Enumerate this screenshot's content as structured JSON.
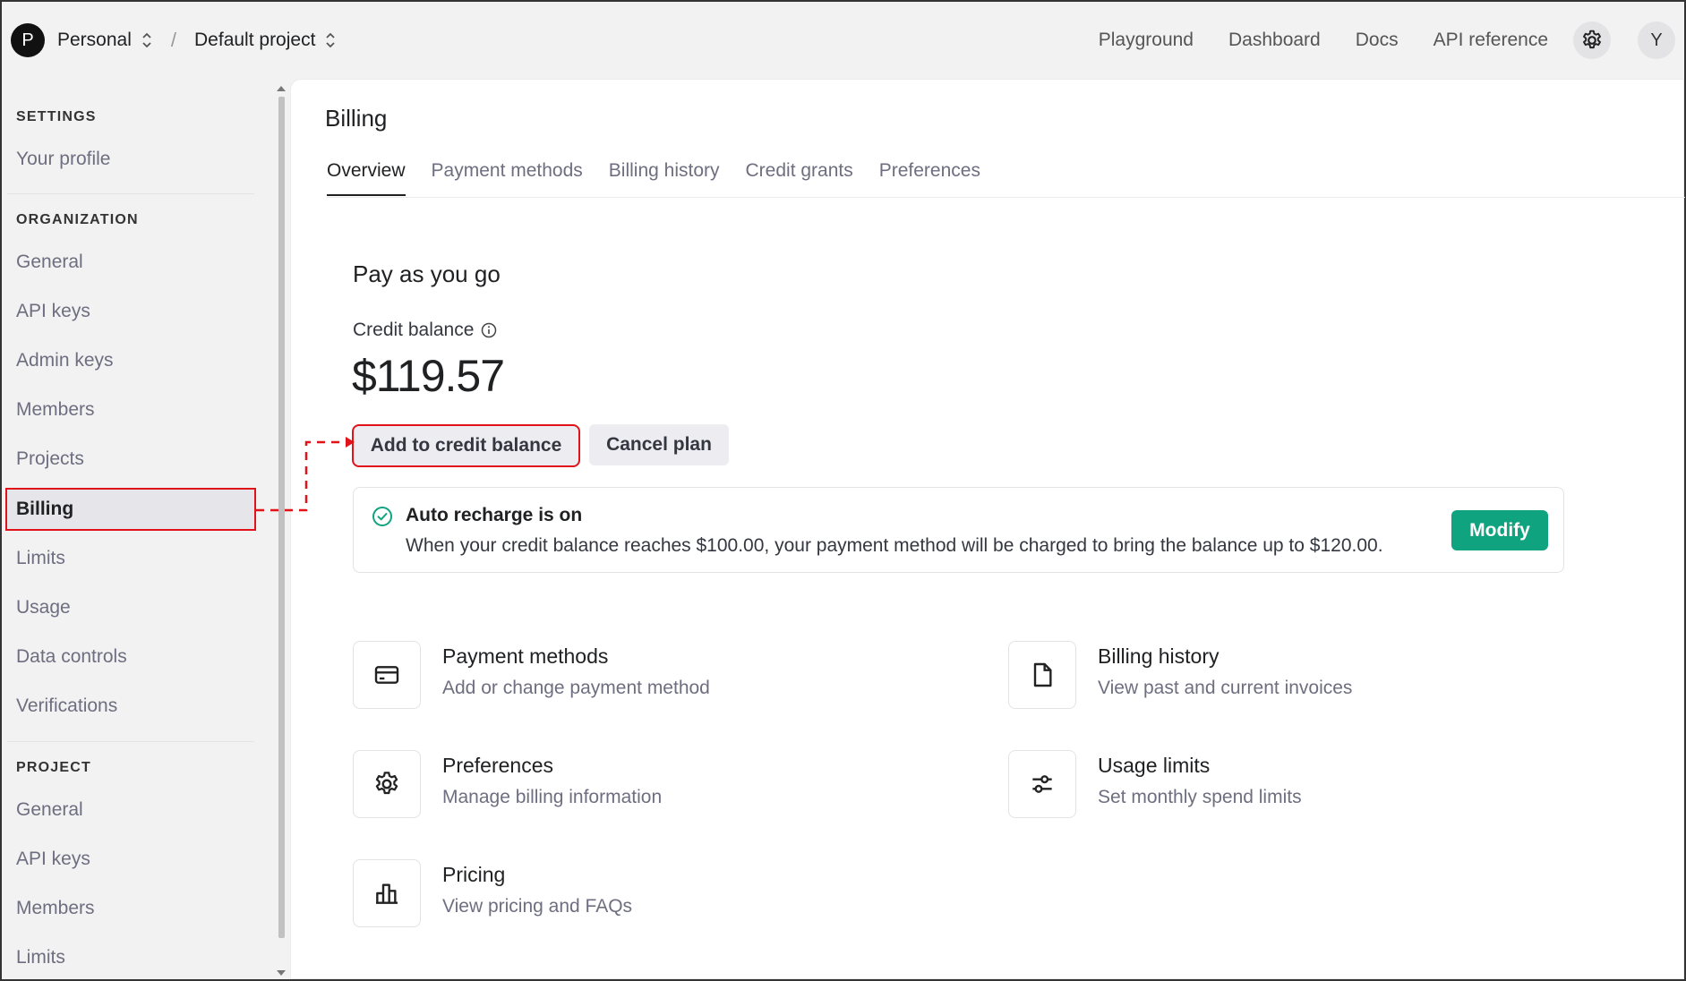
{
  "header": {
    "org_avatar": "P",
    "org_name": "Personal",
    "separator": "/",
    "project_name": "Default project",
    "nav": [
      "Playground",
      "Dashboard",
      "Docs",
      "API reference"
    ],
    "user_avatar": "Y"
  },
  "sidebar": {
    "settings_title": "SETTINGS",
    "settings_items": [
      "Your profile"
    ],
    "organization_title": "ORGANIZATION",
    "organization_items": [
      "General",
      "API keys",
      "Admin keys",
      "Members",
      "Projects",
      "Billing",
      "Limits",
      "Usage",
      "Data controls",
      "Verifications"
    ],
    "project_title": "PROJECT",
    "project_items": [
      "General",
      "API keys",
      "Members",
      "Limits"
    ],
    "active_item": "Billing"
  },
  "main": {
    "title": "Billing",
    "tabs": [
      "Overview",
      "Payment methods",
      "Billing history",
      "Credit grants",
      "Preferences"
    ],
    "active_tab": "Overview",
    "plan_title": "Pay as you go",
    "credit_label": "Credit balance",
    "credit_value": "$119.57",
    "add_credit_label": "Add to credit balance",
    "cancel_plan_label": "Cancel plan",
    "recharge": {
      "title": "Auto recharge is on",
      "description": "When your credit balance reaches $100.00, your payment method will be charged to bring the balance up to $120.00.",
      "modify_label": "Modify"
    },
    "links": [
      {
        "title": "Payment methods",
        "desc": "Add or change payment method",
        "icon": "credit-card-icon"
      },
      {
        "title": "Billing history",
        "desc": "View past and current invoices",
        "icon": "document-icon"
      },
      {
        "title": "Preferences",
        "desc": "Manage billing information",
        "icon": "gear-icon"
      },
      {
        "title": "Usage limits",
        "desc": "Set monthly spend limits",
        "icon": "sliders-icon"
      },
      {
        "title": "Pricing",
        "desc": "View pricing and FAQs",
        "icon": "bar-chart-icon"
      }
    ]
  },
  "colors": {
    "accent_green": "#10a37f",
    "highlight_red": "#e0121a"
  }
}
